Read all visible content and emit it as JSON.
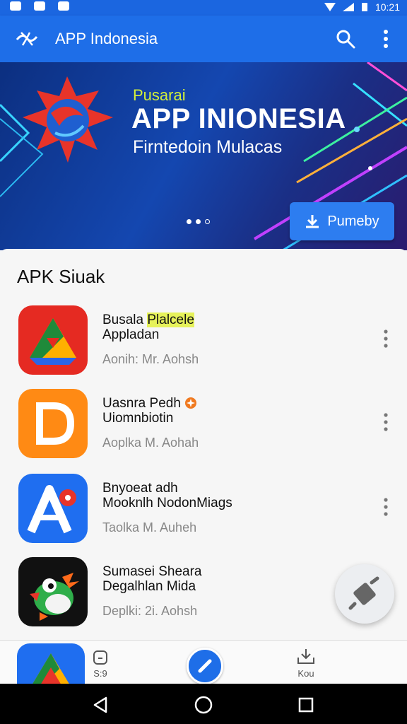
{
  "status_bar": {
    "time": "10:21"
  },
  "app_bar": {
    "title": "APP Indonesia"
  },
  "banner": {
    "subtitle": "Pusarai",
    "headline": "APP INIONESIA",
    "tagline": "Firntedoin Mulacas",
    "download_label": "Pumeby",
    "carousel_total": 3,
    "carousel_active": 1
  },
  "section": {
    "title": "APK Siuak"
  },
  "apps": [
    {
      "name_plain": "Busala ",
      "name_highlight": "Plalcele",
      "name_line2": "Appladan",
      "meta": "Aonih: Mr. Aohsh"
    },
    {
      "name_plain": "Uasnra Pedh",
      "name_line2": "Uiomnbiotin",
      "meta": "Aoplka M. Aohah"
    },
    {
      "name_plain": "Bnyoeat adh",
      "name_line2": "Mooknlh NodonMiags",
      "meta": "Taolka M. Auheh"
    },
    {
      "name_plain": "Sumasei Sheara",
      "name_line2": "Degalhlan Mida",
      "meta": "Deplki: 2i. Aohsh"
    }
  ],
  "bottom_nav": {
    "item1_label": "S:9",
    "item3_label": "Kou"
  },
  "colors": {
    "primary": "#1e6ee8",
    "accent_lime": "#d3f03a"
  }
}
